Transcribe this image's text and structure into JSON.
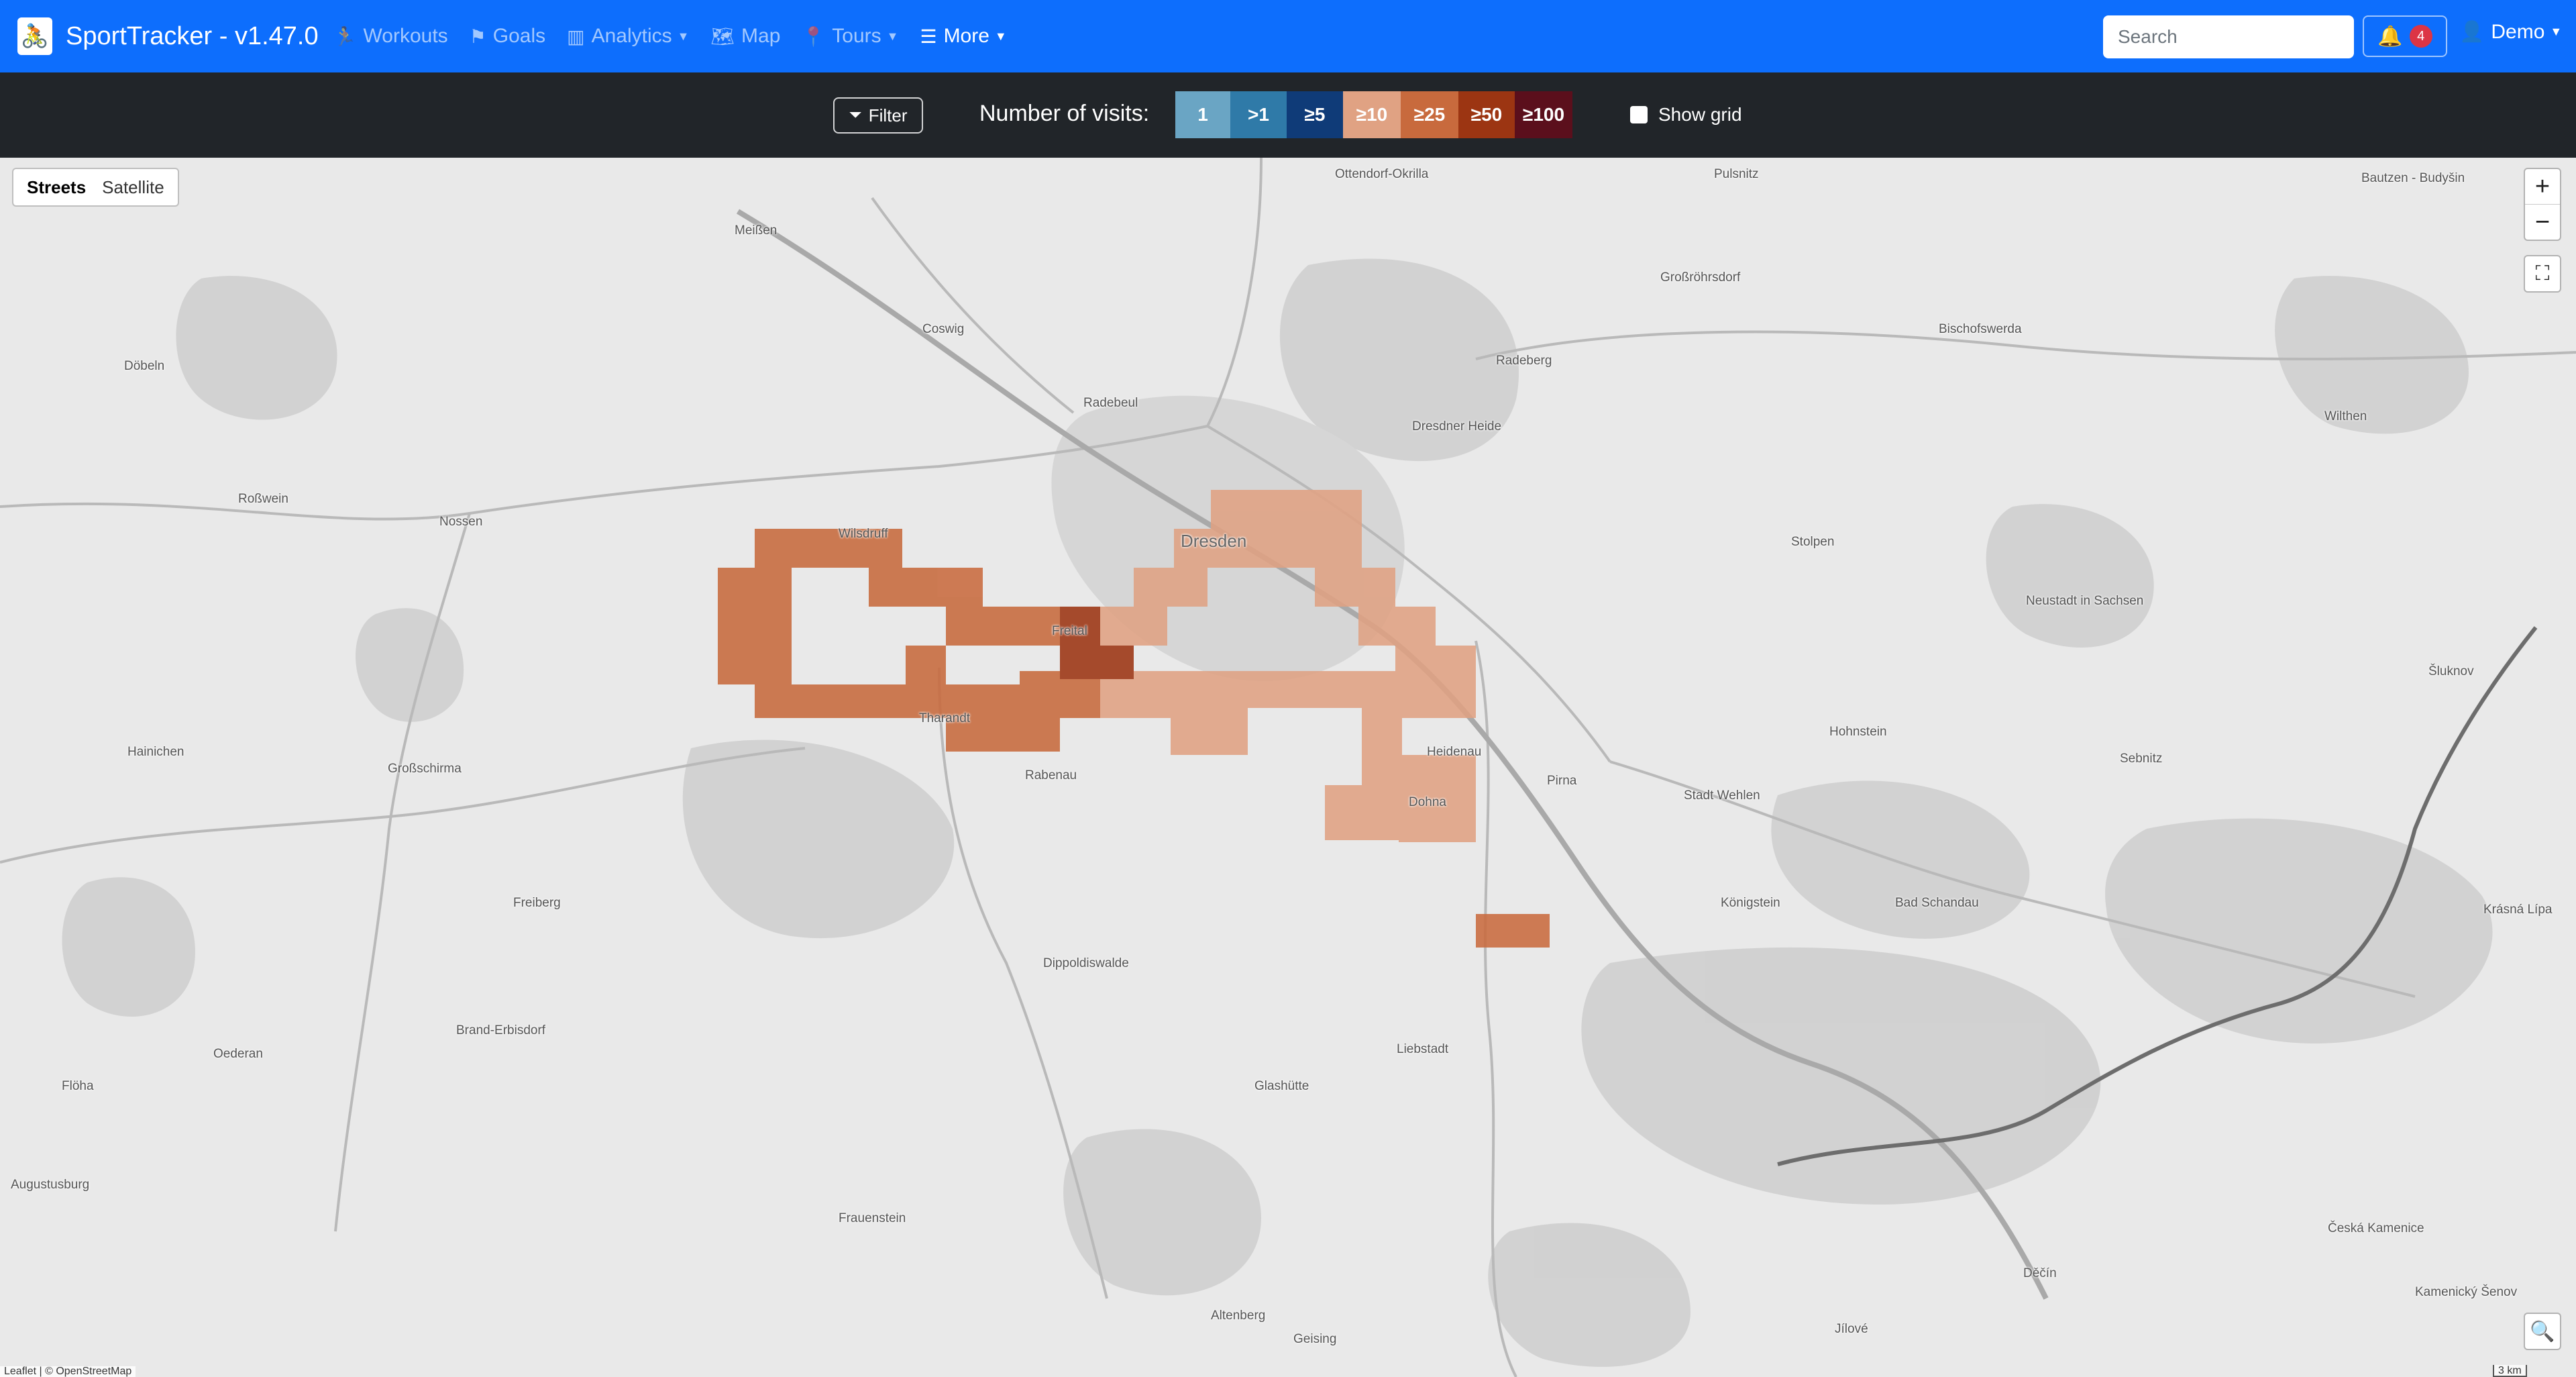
{
  "app": {
    "title": "SportTracker - v1.47.0",
    "logo_icon": "runner-bike-icon"
  },
  "nav": {
    "items": [
      {
        "label": "Workouts",
        "icon": "runner-icon",
        "dropdown": false
      },
      {
        "label": "Goals",
        "icon": "flag-icon",
        "dropdown": false
      },
      {
        "label": "Analytics",
        "icon": "bar-chart-icon",
        "dropdown": true
      },
      {
        "label": "Map",
        "icon": "map-icon",
        "dropdown": false
      },
      {
        "label": "Tours",
        "icon": "pin-icon",
        "dropdown": true
      },
      {
        "label": "More",
        "icon": "list-icon",
        "dropdown": true
      }
    ],
    "search_placeholder": "Search",
    "notification_count": "4",
    "user_label": "Demo"
  },
  "legend": {
    "filter_label": "Filter",
    "title": "Number of visits:",
    "swatches": [
      {
        "label": "1",
        "color": "#6aa5c4"
      },
      {
        "label": ">1",
        "color": "#2f7aa8"
      },
      {
        "label": "≥5",
        "color": "#0f3b78"
      },
      {
        "label": "≥10",
        "color": "#e0a283"
      },
      {
        "label": "≥25",
        "color": "#c86a3d"
      },
      {
        "label": "≥50",
        "color": "#9c3512"
      },
      {
        "label": "≥100",
        "color": "#5b0f1c"
      }
    ],
    "show_grid_label": "Show grid",
    "show_grid_checked": false
  },
  "map": {
    "layers": [
      "Streets",
      "Satellite"
    ],
    "active_layer": "Streets",
    "zoom_in": "+",
    "zoom_out": "−",
    "attribution": "Leaflet | © OpenStreetMap",
    "scale_label": "3 km",
    "places": [
      {
        "name": "Ottendorf-Okrilla"
      },
      {
        "name": "Pulsnitz"
      },
      {
        "name": "Bautzen - Budyšin"
      },
      {
        "name": "Meißen"
      },
      {
        "name": "Großröhrsdorf"
      },
      {
        "name": "Coswig"
      },
      {
        "name": "Radeberg"
      },
      {
        "name": "Bischofswerda"
      },
      {
        "name": "Döbeln"
      },
      {
        "name": "Radebeul"
      },
      {
        "name": "Dresdner Heide"
      },
      {
        "name": "Wilthen"
      },
      {
        "name": "Roßwein"
      },
      {
        "name": "Nossen"
      },
      {
        "name": "Wilsdruff"
      },
      {
        "name": "Dresden"
      },
      {
        "name": "Stolpen"
      },
      {
        "name": "Neustadt in Sachsen"
      },
      {
        "name": "Freital"
      },
      {
        "name": "Šluknov"
      },
      {
        "name": "Hainichen"
      },
      {
        "name": "Tharandt"
      },
      {
        "name": "Rabenau"
      },
      {
        "name": "Hohnstein"
      },
      {
        "name": "Heidenau"
      },
      {
        "name": "Pirna"
      },
      {
        "name": "Stadt Wehlen"
      },
      {
        "name": "Sebnitz"
      },
      {
        "name": "Großschirma"
      },
      {
        "name": "Dohna"
      },
      {
        "name": "Freiberg"
      },
      {
        "name": "Königstein"
      },
      {
        "name": "Bad Schandau"
      },
      {
        "name": "Krásná Lípa"
      },
      {
        "name": "Dippoldiswalde"
      },
      {
        "name": "Brand-Erbisdorf"
      },
      {
        "name": "Oederan"
      },
      {
        "name": "Liebstadt"
      },
      {
        "name": "Flöha"
      },
      {
        "name": "Glashütte"
      },
      {
        "name": "Augustusburg"
      },
      {
        "name": "Frauenstein"
      },
      {
        "name": "Česká Kamenice"
      },
      {
        "name": "Děčín"
      },
      {
        "name": "Altenberg"
      },
      {
        "name": "Geising"
      },
      {
        "name": "Jílové"
      },
      {
        "name": "Kamenický Šenov"
      }
    ],
    "heat_cells": [
      {
        "tier": "≥10"
      },
      {
        "tier": "≥25"
      },
      {
        "tier": "≥50"
      }
    ]
  }
}
